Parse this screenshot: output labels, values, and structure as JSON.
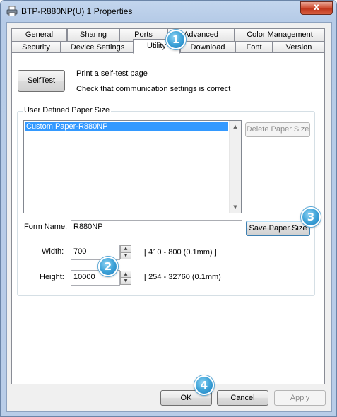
{
  "window": {
    "title": "BTP-R880NP(U) 1 Properties",
    "close_glyph": "x"
  },
  "tabs": {
    "row1": [
      "General",
      "Sharing",
      "Ports",
      "Advanced",
      "Color Management"
    ],
    "row2": [
      "Security",
      "Device Settings",
      "Utility",
      "Download",
      "Font",
      "Version"
    ],
    "active": "Utility"
  },
  "selftest": {
    "button_label": "SelfTest",
    "line1": "Print a self-test page",
    "line2": "Check that communication settings is correct"
  },
  "paper_group": {
    "label": "User Defined Paper Size",
    "list_items": [
      "Custom Paper-R880NP"
    ],
    "delete_button": "Delete Paper Size",
    "form_name_label": "Form Name:",
    "form_name_value": "R880NP",
    "save_button": "Save Paper Size",
    "width_label": "Width:",
    "width_value": "700",
    "width_range": "[ 410 - 800 (0.1mm) ]",
    "height_label": "Height:",
    "height_value": "10000",
    "height_range": "[ 254 - 32760 (0.1mm)"
  },
  "footer": {
    "ok": "OK",
    "cancel": "Cancel",
    "apply": "Apply"
  },
  "badges": [
    "1",
    "2",
    "3",
    "4"
  ],
  "colors": {
    "selection": "#3399ff",
    "badge": "#3ea3d8",
    "close_button": "#c0371d"
  }
}
